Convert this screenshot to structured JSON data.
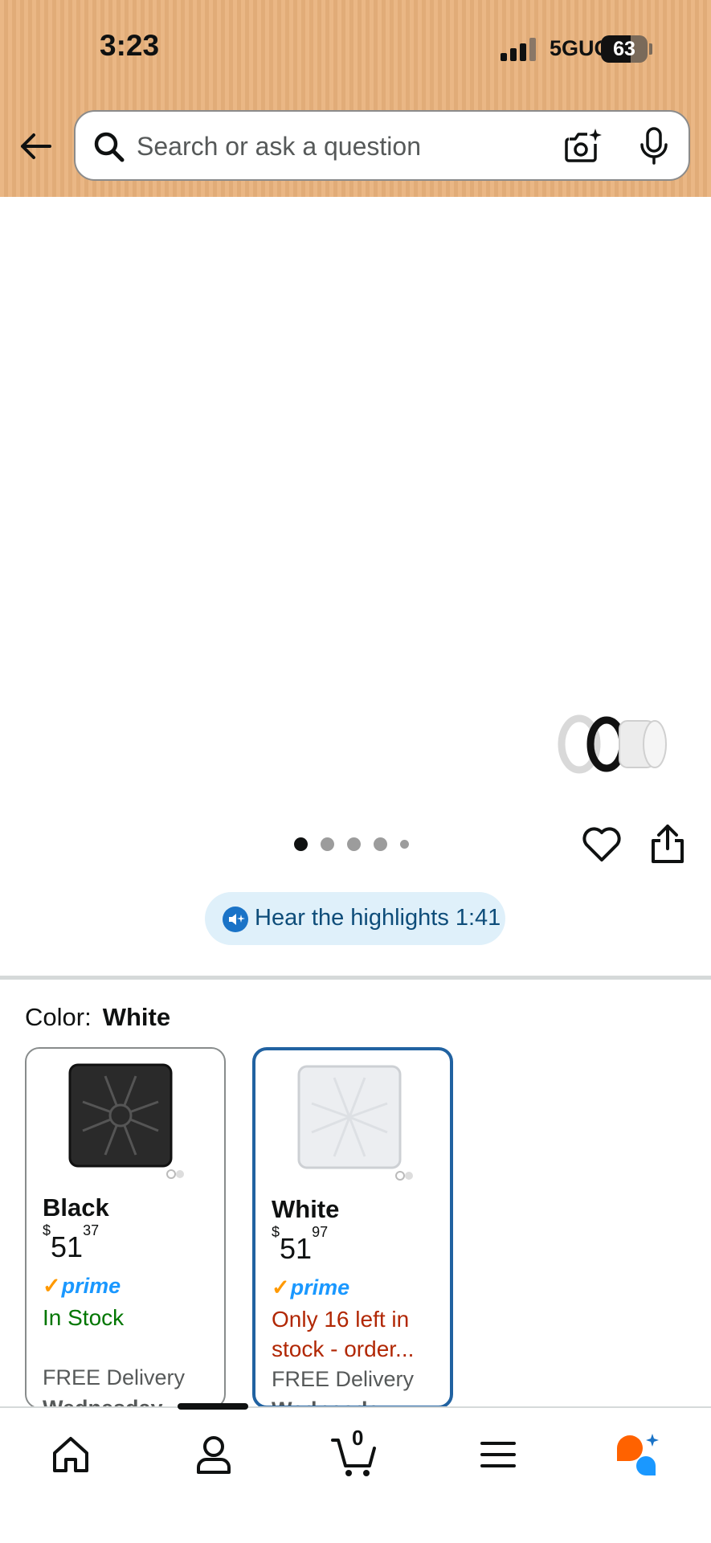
{
  "status_bar": {
    "time": "3:23",
    "network": "5GUC",
    "battery": "63",
    "battery_level": 0.63
  },
  "header": {
    "search_placeholder": "Search or ask a question",
    "icons": [
      "back-arrow-icon",
      "search-icon",
      "camera-icon",
      "mic-icon"
    ]
  },
  "gallery": {
    "image_count": 5,
    "current_index": 0,
    "icons": [
      "heart-icon",
      "share-icon"
    ]
  },
  "highlights": {
    "label": "Hear the highlights 1:41"
  },
  "color": {
    "label": "Color:",
    "selected": "White",
    "options": [
      {
        "name": "Black",
        "price_symbol": "$",
        "price_whole": "51",
        "price_fraction": "37",
        "prime": "prime",
        "stock": "In Stock",
        "delivery": "FREE Delivery",
        "delivery_day": "Wednesday"
      },
      {
        "name": "White",
        "price_symbol": "$",
        "price_whole": "51",
        "price_fraction": "97",
        "prime": "prime",
        "stock": "Only 16 left in stock - order...",
        "delivery": "FREE Delivery",
        "delivery_day": "Wednesday"
      }
    ]
  },
  "bottom_nav": {
    "items": [
      "home-icon",
      "account-icon",
      "cart-icon",
      "menu-icon",
      "rufus-assistant-icon"
    ],
    "cart_count": "0",
    "active_index": 1
  },
  "colors": {
    "header_bg": "#e8b27c",
    "selected_border": "#2162a1",
    "in_stock": "#007600",
    "low_stock": "#b12704",
    "prime_blue": "#1a98ff",
    "prime_check": "#ff9900"
  }
}
